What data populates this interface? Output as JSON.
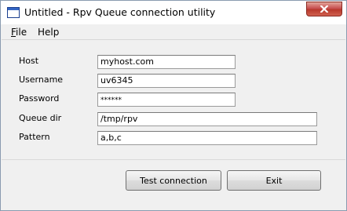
{
  "window": {
    "title": "Untitled - Rpv Queue connection utility"
  },
  "menu": {
    "file": {
      "accel": "F",
      "rest": "ile"
    },
    "help": {
      "accel": "",
      "rest": "Help"
    }
  },
  "form": {
    "host": {
      "label": "Host",
      "value": "myhost.com"
    },
    "username": {
      "label": "Username",
      "value": "uv6345"
    },
    "password": {
      "label": "Password",
      "value": "******"
    },
    "queue_dir": {
      "label": "Queue dir",
      "value": "/tmp/rpv"
    },
    "pattern": {
      "label": "Pattern",
      "value": "a,b,c"
    }
  },
  "buttons": {
    "test_connection": "Test connection",
    "exit": "Exit"
  },
  "icons": {
    "app": "window-icon",
    "close": "close-icon"
  },
  "colors": {
    "close_button": "#c75050",
    "window_background": "#f0f0f0"
  }
}
